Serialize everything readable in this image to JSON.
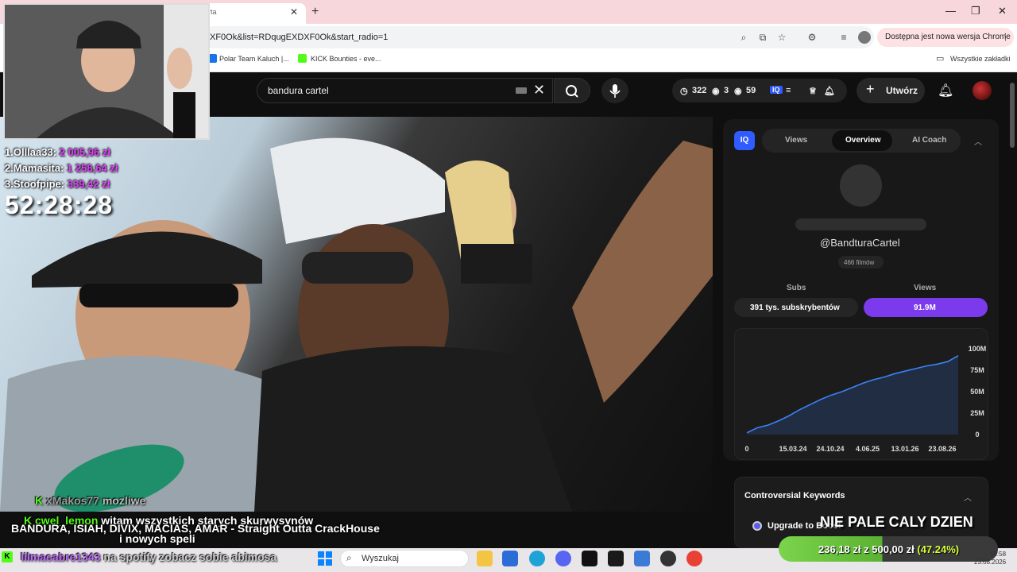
{
  "browser": {
    "tab_title": "rta",
    "url": "XF0Ok&list=RDqugEXDXF0Ok&start_radio=1",
    "update_label": "Dostępna jest nowa wersja Chrome",
    "bookmarks": [
      {
        "label": "Polar Team Kaluch |...",
        "color": "#1a73e8"
      },
      {
        "label": "KICK Bounties - eve...",
        "color": "#53fc18"
      }
    ],
    "all_bookmarks": "Wszystkie zakładki"
  },
  "youtube": {
    "search_query": "bandura cartel",
    "stats": {
      "history": "322",
      "views_a": "3",
      "views_b": "59"
    },
    "create_label": "Utwórz"
  },
  "panel": {
    "logo": "IQ",
    "tabs": [
      "Views",
      "Overview",
      "AI Coach"
    ],
    "active_tab": "Overview",
    "handle": "@BandturaCartel",
    "films": "466 filmów",
    "subs_label": "Subs",
    "views_label": "Views",
    "subs_value": "391 tys. subskrybentów",
    "views_value": "91.9M",
    "controversial_title": "Controversial Keywords",
    "upgrade_label": "Upgrade to Boost"
  },
  "chart_data": {
    "type": "area",
    "x_labels": [
      "0",
      "15.03.24",
      "24.10.24",
      "4.06.25",
      "13.01.26",
      "23.08.26"
    ],
    "y_ticks": [
      "0",
      "25M",
      "50M",
      "75M",
      "100M"
    ],
    "ylim": [
      0,
      100
    ],
    "x": [
      0,
      0.05,
      0.1,
      0.15,
      0.2,
      0.25,
      0.3,
      0.35,
      0.4,
      0.45,
      0.5,
      0.55,
      0.6,
      0.65,
      0.7,
      0.75,
      0.8,
      0.85,
      0.9,
      0.95,
      1.0
    ],
    "values": [
      2,
      8,
      11,
      16,
      22,
      29,
      35,
      41,
      46,
      50,
      55,
      60,
      64,
      67,
      71,
      74,
      77,
      80,
      82,
      85,
      91.9
    ],
    "color": "#3b82f6"
  },
  "stream": {
    "donors": [
      {
        "rank": "1.",
        "name": "Olllaa33:",
        "amount": "2 005,96 zł"
      },
      {
        "rank": "2.",
        "name": "Mamasita:",
        "amount": "1 258,64 zł"
      },
      {
        "rank": "3.",
        "name": "Stoofpipe:",
        "amount": "339,42 zł"
      }
    ],
    "timer": "52:28:28",
    "chat": [
      {
        "user": "xMakos77",
        "text": "mozliwe",
        "user_color": "#9a9a9a",
        "text_color": "#bbbbbb"
      },
      {
        "user": "cwel_lemon",
        "text": "witam wszystkich starych skurwysynów",
        "user_color": "#53fc18",
        "text_color": "#ffffff"
      },
      {
        "user": "lilmacabre1343",
        "text": "na spotify zobacz sobie abimosa",
        "user_color": "#c06bff",
        "text_color": "#cccccc"
      }
    ],
    "song": "BANDURA, ISIAH, DIVIX, MACIAS, AMAR - Straight Outta CrackHouse",
    "song_extra": "i nowych speli",
    "big_text": "NIE PALE CALY DZIEN",
    "goal": {
      "current": "236,18 zł",
      "sep": "z",
      "target": "500,00 zł",
      "pct": "(47.24%)",
      "fraction": 0.4724
    }
  },
  "taskbar": {
    "search_label": "Wyszukaj",
    "time": "16:58",
    "date": "23.08.2026"
  }
}
